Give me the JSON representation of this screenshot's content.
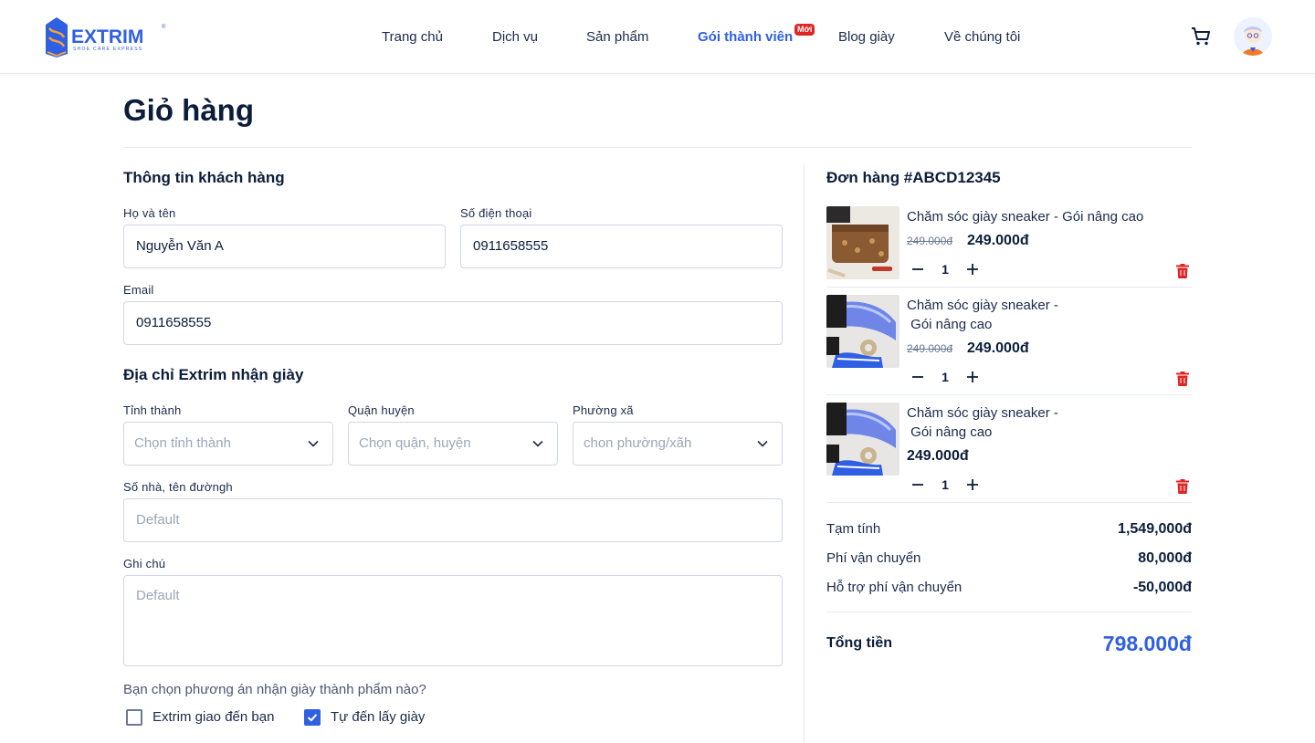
{
  "header": {
    "logo_text": "EXTRIM",
    "logo_tagline": "SHOE CARE EXPRESS",
    "nav": [
      {
        "label": "Trang chủ",
        "active": false
      },
      {
        "label": "Dịch vụ",
        "active": false
      },
      {
        "label": "Sản phẩm",
        "active": false
      },
      {
        "label": "Gói thành viên",
        "active": true
      },
      {
        "label": "Blog giày",
        "active": false
      },
      {
        "label": "Về chúng tôi",
        "active": false
      }
    ],
    "new_badge": "Mới",
    "cart_icon": "cart-icon",
    "accent_color": "#2f5fe3"
  },
  "page_title": "Giỏ hàng",
  "customer": {
    "section_title": "Thông tin khách hàng",
    "name_label": "Họ và tên",
    "name_value": "Nguyễn Văn A",
    "phone_label": "Số điện thoại",
    "phone_value": "0911658555",
    "email_label": "Email",
    "email_value": "0911658555"
  },
  "address": {
    "section_title": "Địa chỉ Extrim nhận giày",
    "province_label": "Tỉnh thành",
    "province_placeholder": "Chọn tỉnh thành",
    "district_label": "Quận huyện",
    "district_placeholder": "Chọn quận, huyện",
    "ward_label": "Phường xã",
    "ward_placeholder": "chon phường/xãh",
    "street_label": "Số nhà, tên đườngh",
    "street_placeholder": "Default",
    "note_label": "Ghi chú",
    "note_placeholder": "Default"
  },
  "delivery": {
    "question": "Bạn chọn phương án nhận giày thành phẩm nào?",
    "options": [
      {
        "label": "Extrim giao đến bạn",
        "checked": false
      },
      {
        "label": "Tự đến lấy giày",
        "checked": true
      }
    ]
  },
  "order": {
    "title": "Đơn hàng #ABCD12345",
    "items": [
      {
        "name_line1": "Chăm sóc giày sneaker - Gói nâng cao",
        "name_line2": "",
        "old_price": "249.000đ",
        "price": "249.000đ",
        "qty": "1",
        "image": "bag-image"
      },
      {
        "name_line1": "Chăm sóc giày sneaker -",
        "name_line2": " Gói nâng cao",
        "old_price": "249.000đ",
        "price": "249.000đ",
        "qty": "1",
        "image": "sneaker-image"
      },
      {
        "name_line1": "Chăm sóc giày sneaker -",
        "name_line2": " Gói nâng cao",
        "old_price": "",
        "price": "249.000đ",
        "qty": "1",
        "image": "sneaker-image"
      }
    ],
    "subtotal_label": "Tạm tính",
    "subtotal_value": "1,549,000đ",
    "shipping_label": "Phí vận chuyển",
    "shipping_value": "80,000đ",
    "shipping_support_label": "Hỗ trợ phí vận chuyển",
    "shipping_support_value": "-50,000đ",
    "total_label": "Tổng tiền",
    "total_value": "798.000đ"
  }
}
